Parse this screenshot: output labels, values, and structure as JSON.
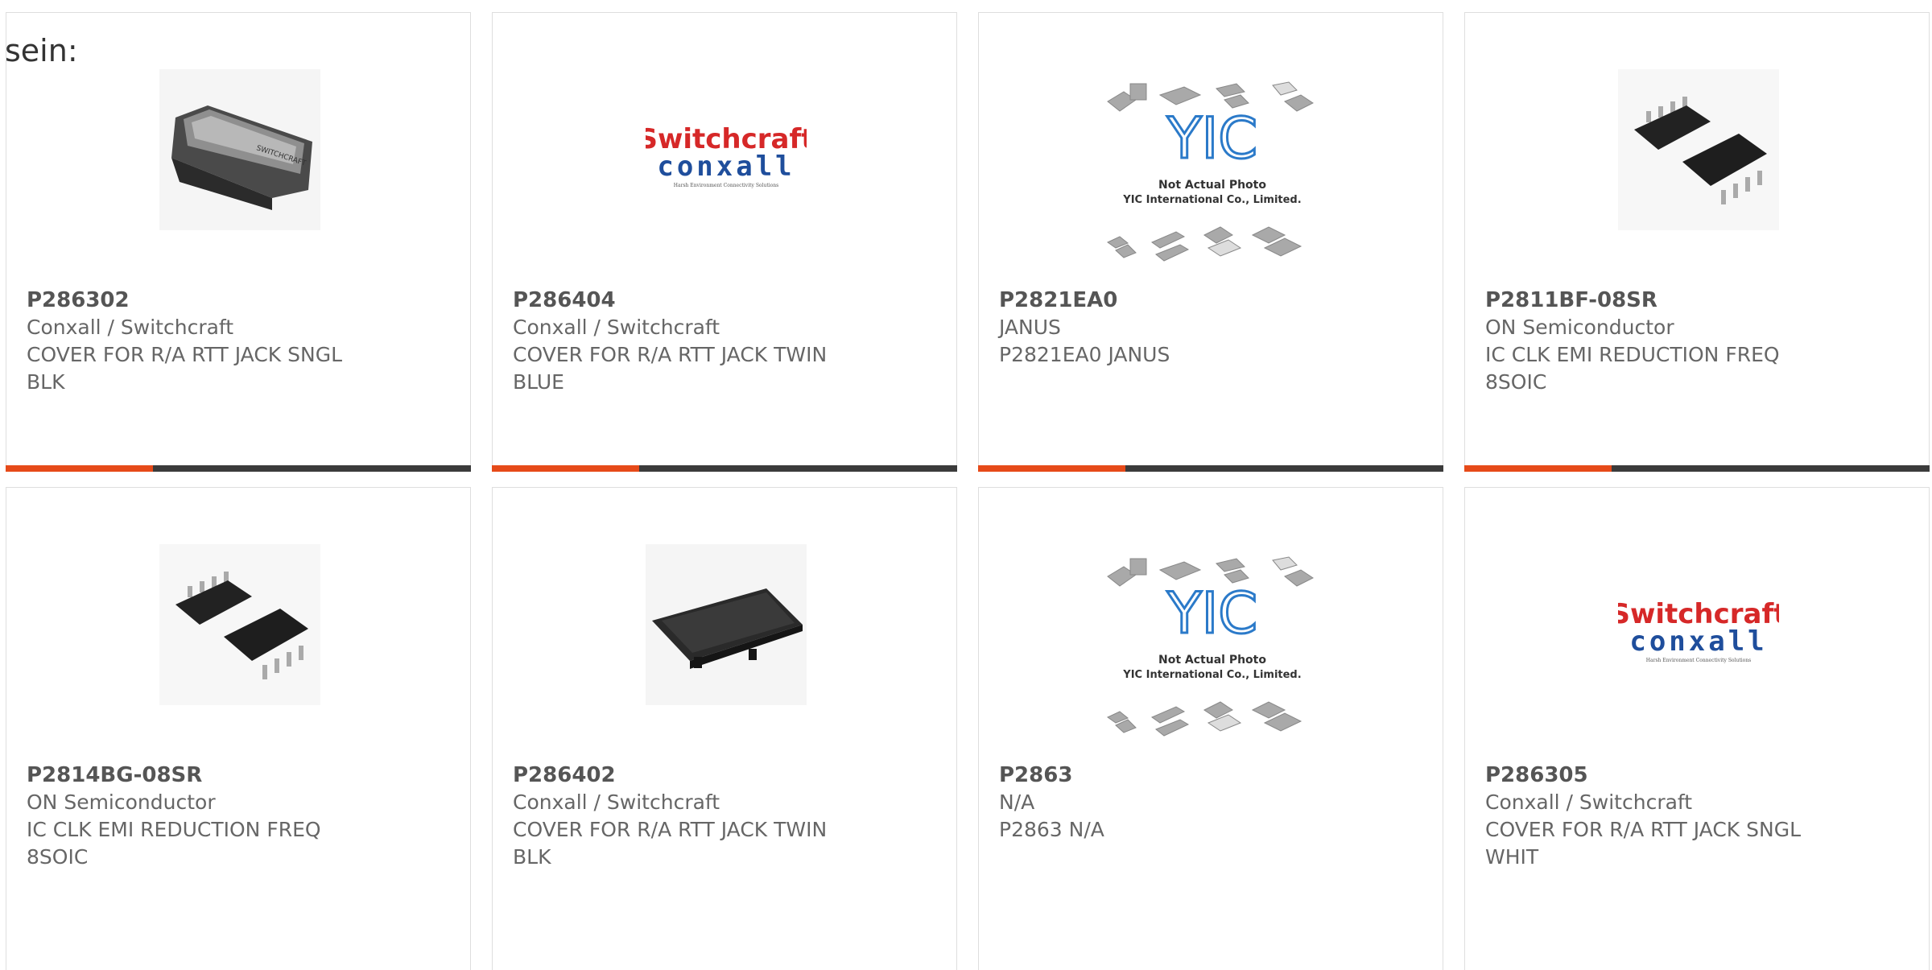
{
  "page_label": "sein:",
  "colors": {
    "accent": "#e64a19",
    "bar": "#3b3b3b",
    "border": "#dedede"
  },
  "products": [
    {
      "part": "P286302",
      "maker": "Conxall / Switchcraft",
      "desc1": "COVER FOR R/A RTT JACK SNGL",
      "desc2": "BLK",
      "image": "jack-cover-single-photo"
    },
    {
      "part": "P286404",
      "maker": "Conxall / Switchcraft",
      "desc1": "COVER FOR R/A RTT JACK TWIN",
      "desc2": "BLUE",
      "image": "switchcraft-conxall-logo"
    },
    {
      "part": "P2821EA0",
      "maker": "JANUS",
      "desc1": "P2821EA0 JANUS",
      "desc2": "",
      "image": "yic-placeholder"
    },
    {
      "part": "P2811BF-08SR",
      "maker": "ON Semiconductor",
      "desc1": "IC CLK EMI REDUCTION FREQ",
      "desc2": "8SOIC",
      "image": "soic8-chip-photo"
    },
    {
      "part": "P2814BG-08SR",
      "maker": "ON Semiconductor",
      "desc1": "IC CLK EMI REDUCTION FREQ",
      "desc2": "8SOIC",
      "image": "soic8-chip-photo"
    },
    {
      "part": "P286402",
      "maker": "Conxall / Switchcraft",
      "desc1": "COVER FOR R/A RTT JACK TWIN",
      "desc2": "BLK",
      "image": "jack-cover-twin-photo"
    },
    {
      "part": "P2863",
      "maker": "N/A",
      "desc1": "P2863 N/A",
      "desc2": "",
      "image": "yic-placeholder"
    },
    {
      "part": "P286305",
      "maker": "Conxall / Switchcraft",
      "desc1": "COVER FOR R/A RTT JACK SNGL",
      "desc2": "WHIT",
      "image": "switchcraft-conxall-logo"
    }
  ],
  "logo": {
    "brand_top": "Switchcraft",
    "brand_bottom": "conxall",
    "tagline": "Harsh Environment Connectivity Solutions"
  },
  "placeholder": {
    "logo_text": "YIC",
    "line1": "Not Actual Photo",
    "line2": "YIC International Co., Limited."
  }
}
